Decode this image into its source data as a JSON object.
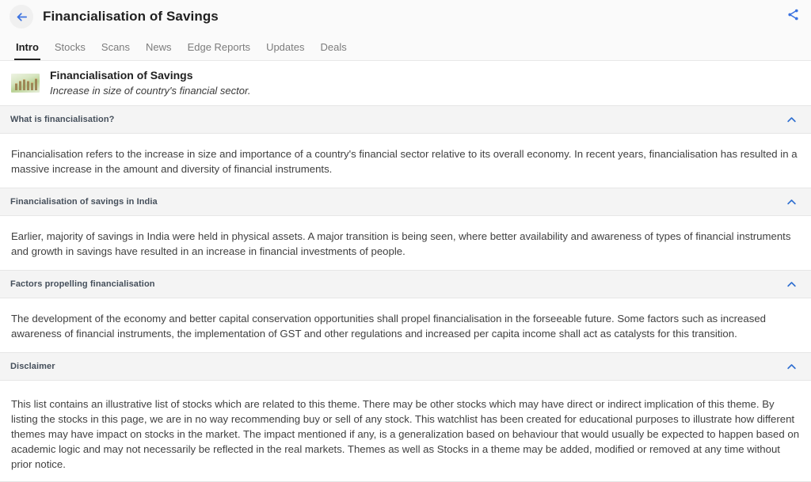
{
  "header": {
    "title": "Financialisation of Savings",
    "back_icon": "arrow-left-icon",
    "share_icon": "share-icon",
    "accent_color": "#3b72e0"
  },
  "tabs": [
    {
      "label": "Intro",
      "active": true
    },
    {
      "label": "Stocks",
      "active": false
    },
    {
      "label": "Scans",
      "active": false
    },
    {
      "label": "News",
      "active": false
    },
    {
      "label": "Edge Reports",
      "active": false
    },
    {
      "label": "Updates",
      "active": false
    },
    {
      "label": "Deals",
      "active": false
    }
  ],
  "theme": {
    "thumbnail_icon": "coin-stacks-thumbnail",
    "name": "Financialisation of Savings",
    "subtitle": "Increase in size of country's financial sector."
  },
  "sections": [
    {
      "title": "What is financialisation?",
      "chevron_icon": "chevron-up-icon",
      "body": "Financialisation refers to the increase in size and importance of a country's financial sector relative to its overall economy. In recent years, financialisation has resulted in a massive increase in the amount and diversity of financial instruments."
    },
    {
      "title": "Financialisation of savings in India",
      "chevron_icon": "chevron-up-icon",
      "body": "Earlier, majority of savings in India were held in physical assets. A major transition is being seen, where better availability and awareness of types of financial instruments and growth in savings have resulted in an increase in financial investments of people."
    },
    {
      "title": "Factors propelling financialisation",
      "chevron_icon": "chevron-up-icon",
      "body": "The development of the economy and better capital conservation opportunities shall propel financialisation in the forseeable future. Some factors such as increased awareness of financial instruments, the implementation of GST and other regulations and increased per capita income shall act as catalysts for this transition."
    },
    {
      "title": "Disclaimer",
      "chevron_icon": "chevron-up-icon",
      "body": "This list contains an illustrative list of stocks which are related to this theme. There may be other stocks which may have direct or indirect implication of this theme. By listing the stocks in this page, we are in no way recommending buy or sell of any stock. This watchlist has been created for educational purposes to illustrate how different themes may have impact on stocks in the market. The impact mentioned if any, is a generalization based on behaviour that would usually be expected to happen based on academic logic and may not necessarily be reflected in the real markets. Themes as well as Stocks in a theme may be added, modified or removed at any time without prior notice."
    }
  ]
}
